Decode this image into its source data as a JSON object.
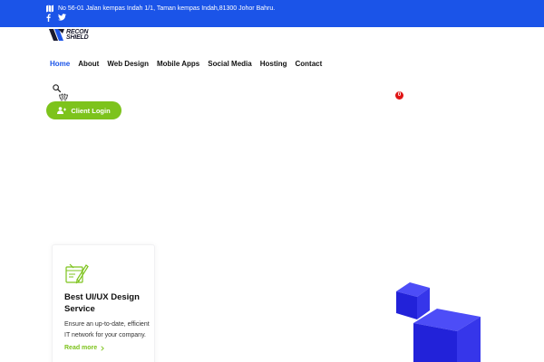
{
  "topbar": {
    "address": "No 56-01 Jalan kempas Indah 1/1, Taman kempas Indah,81300 Johor Bahru.",
    "social": [
      "facebook-icon",
      "twitter-icon"
    ],
    "color": "#1b54e8"
  },
  "logo": {
    "line1": "RECON",
    "line2": "SHIELD"
  },
  "nav": {
    "items": [
      {
        "label": "Home",
        "active": true
      },
      {
        "label": "About",
        "active": false
      },
      {
        "label": "Web Design",
        "active": false
      },
      {
        "label": "Mobile Apps",
        "active": false
      },
      {
        "label": "Social Media",
        "active": false
      },
      {
        "label": "Hosting",
        "active": false
      },
      {
        "label": "Contact",
        "active": false
      }
    ],
    "active_color": "#1b54e8"
  },
  "cart": {
    "count": "0"
  },
  "client_login": {
    "label": "Client Login",
    "color": "#7dc31c"
  },
  "service_card": {
    "title": "Best UI/UX Design Service",
    "text": "Ensure an up-to-date, efficient IT network for your company.",
    "link": "Read more",
    "link_color": "#7dc31c"
  },
  "decor": {
    "cube_color": "#2b2bf0"
  }
}
